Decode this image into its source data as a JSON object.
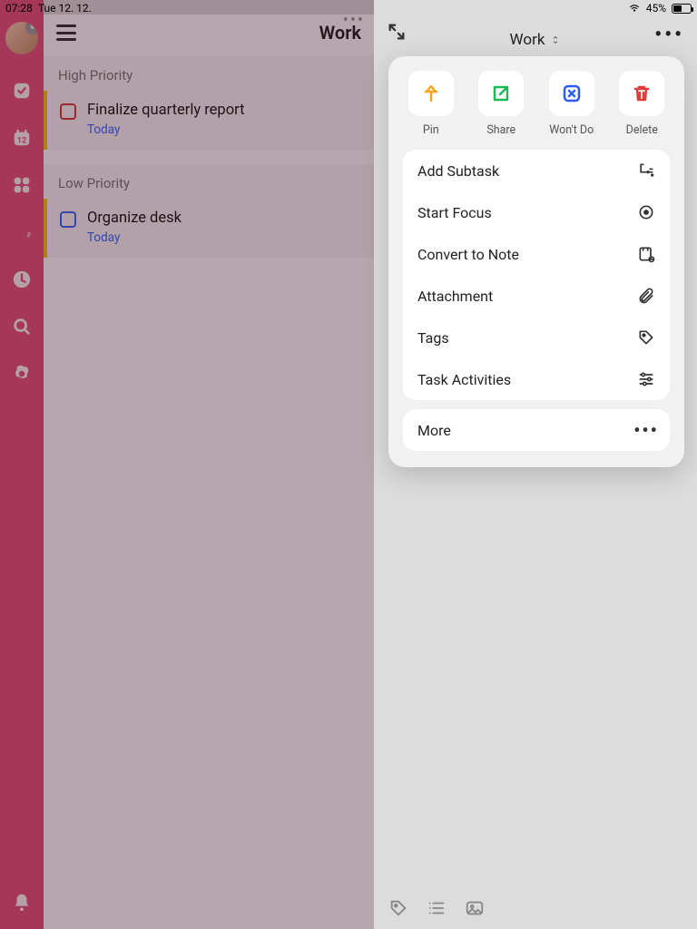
{
  "status": {
    "time": "07:28",
    "date": "Tue 12. 12.",
    "battery_pct": "45%"
  },
  "calendar_badge": "12",
  "main": {
    "title": "Work",
    "sections": [
      {
        "label": "High Priority",
        "task": {
          "title": "Finalize quarterly report",
          "date": "Today"
        }
      },
      {
        "label": "Low Priority",
        "task": {
          "title": "Organize desk",
          "date": "Today"
        }
      }
    ]
  },
  "detail": {
    "title": "Work"
  },
  "actions": {
    "pin": "Pin",
    "share": "Share",
    "wontdo": "Won't Do",
    "delete": "Delete"
  },
  "menu": {
    "add_subtask": "Add Subtask",
    "start_focus": "Start Focus",
    "convert_note": "Convert to Note",
    "attachment": "Attachment",
    "tags": "Tags",
    "activities": "Task Activities",
    "more": "More"
  }
}
